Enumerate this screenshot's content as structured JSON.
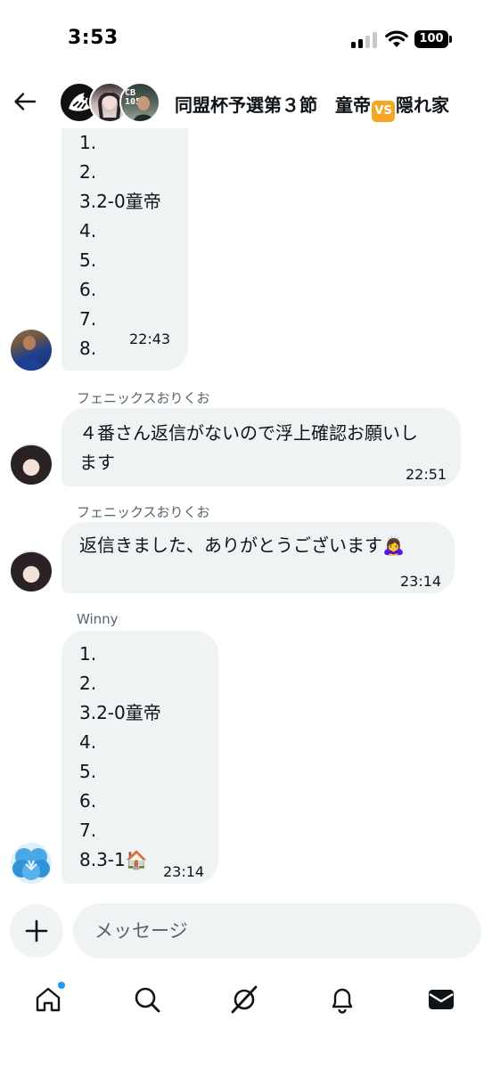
{
  "status_bar": {
    "time": "3:53",
    "battery": "100"
  },
  "header": {
    "title_part1": "同盟杯予選第３節　童帝",
    "vs_icon": "VS",
    "title_part2": "隠れ家",
    "avatar3_badge": "CB\n105"
  },
  "messages": [
    {
      "lines": [
        "1.",
        "2.",
        "3.2-0童帝",
        "4.",
        "5.",
        "6.",
        "7.",
        "8."
      ],
      "time": "22:43"
    },
    {
      "sender": "フェニックスおりくお",
      "lines": [
        "４番さん返信がないので浮上確認お願いし",
        "ます"
      ],
      "time": "22:51"
    },
    {
      "sender": "フェニックスおりくお",
      "lines": [
        "返信きました、ありがとうございます🙇‍♀️"
      ],
      "time": "23:14"
    },
    {
      "sender": "Winny",
      "lines": [
        "1.",
        "2.",
        "3.2-0童帝",
        "4.",
        "5.",
        "6.",
        "7.",
        "8.3-1🏠"
      ],
      "time": "23:14"
    }
  ],
  "composer": {
    "placeholder": "メッセージ"
  },
  "nav": {
    "items": [
      "home-icon",
      "search-icon",
      "grok-icon",
      "bell-icon",
      "mail-icon"
    ]
  },
  "colors": {
    "bubble": "#eff3f4",
    "accent": "#1d9bf0",
    "muted": "#536471",
    "vs_orange": "#f5a623"
  }
}
